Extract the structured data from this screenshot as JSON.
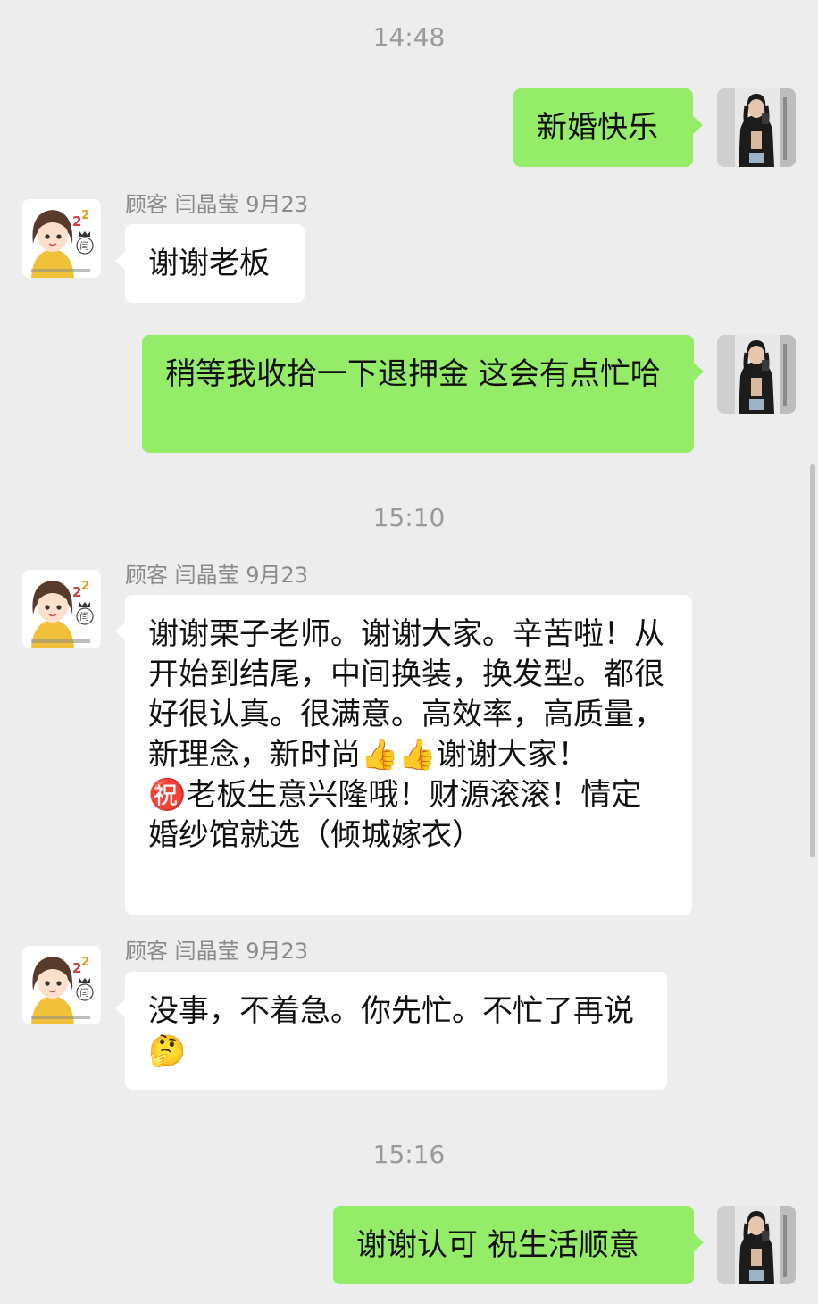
{
  "timestamps": [
    "14:48",
    "15:10",
    "15:16"
  ],
  "contact": {
    "label": "顾客 闫晶莹 9月23"
  },
  "messages": [
    {
      "side": "out",
      "text": "新婚快乐"
    },
    {
      "side": "in",
      "text": "谢谢老板"
    },
    {
      "side": "out",
      "text": "稍等我收拾一下退押金 这会有点忙哈"
    },
    {
      "side": "in",
      "text": "谢谢栗子老师。谢谢大家。辛苦啦！从开始到结尾，中间换装，换发型。都很好很认真。很满意。高效率，高质量，新理念，新时尚👍👍谢谢大家！\n㊗️老板生意兴隆哦！财源滚滚！情定婚纱馆就选（倾城嫁衣）"
    },
    {
      "side": "in",
      "text": "没事，不着急。你先忙。不忙了再说🤔"
    },
    {
      "side": "out",
      "text": "谢谢认可 祝生活顺意"
    }
  ],
  "colors": {
    "background": "#ededed",
    "outgoing_bubble": "#95ec69",
    "incoming_bubble": "#ffffff"
  },
  "icons": {
    "customer_avatar": "customer-avatar-icon",
    "self_avatar": "self-avatar-icon"
  }
}
